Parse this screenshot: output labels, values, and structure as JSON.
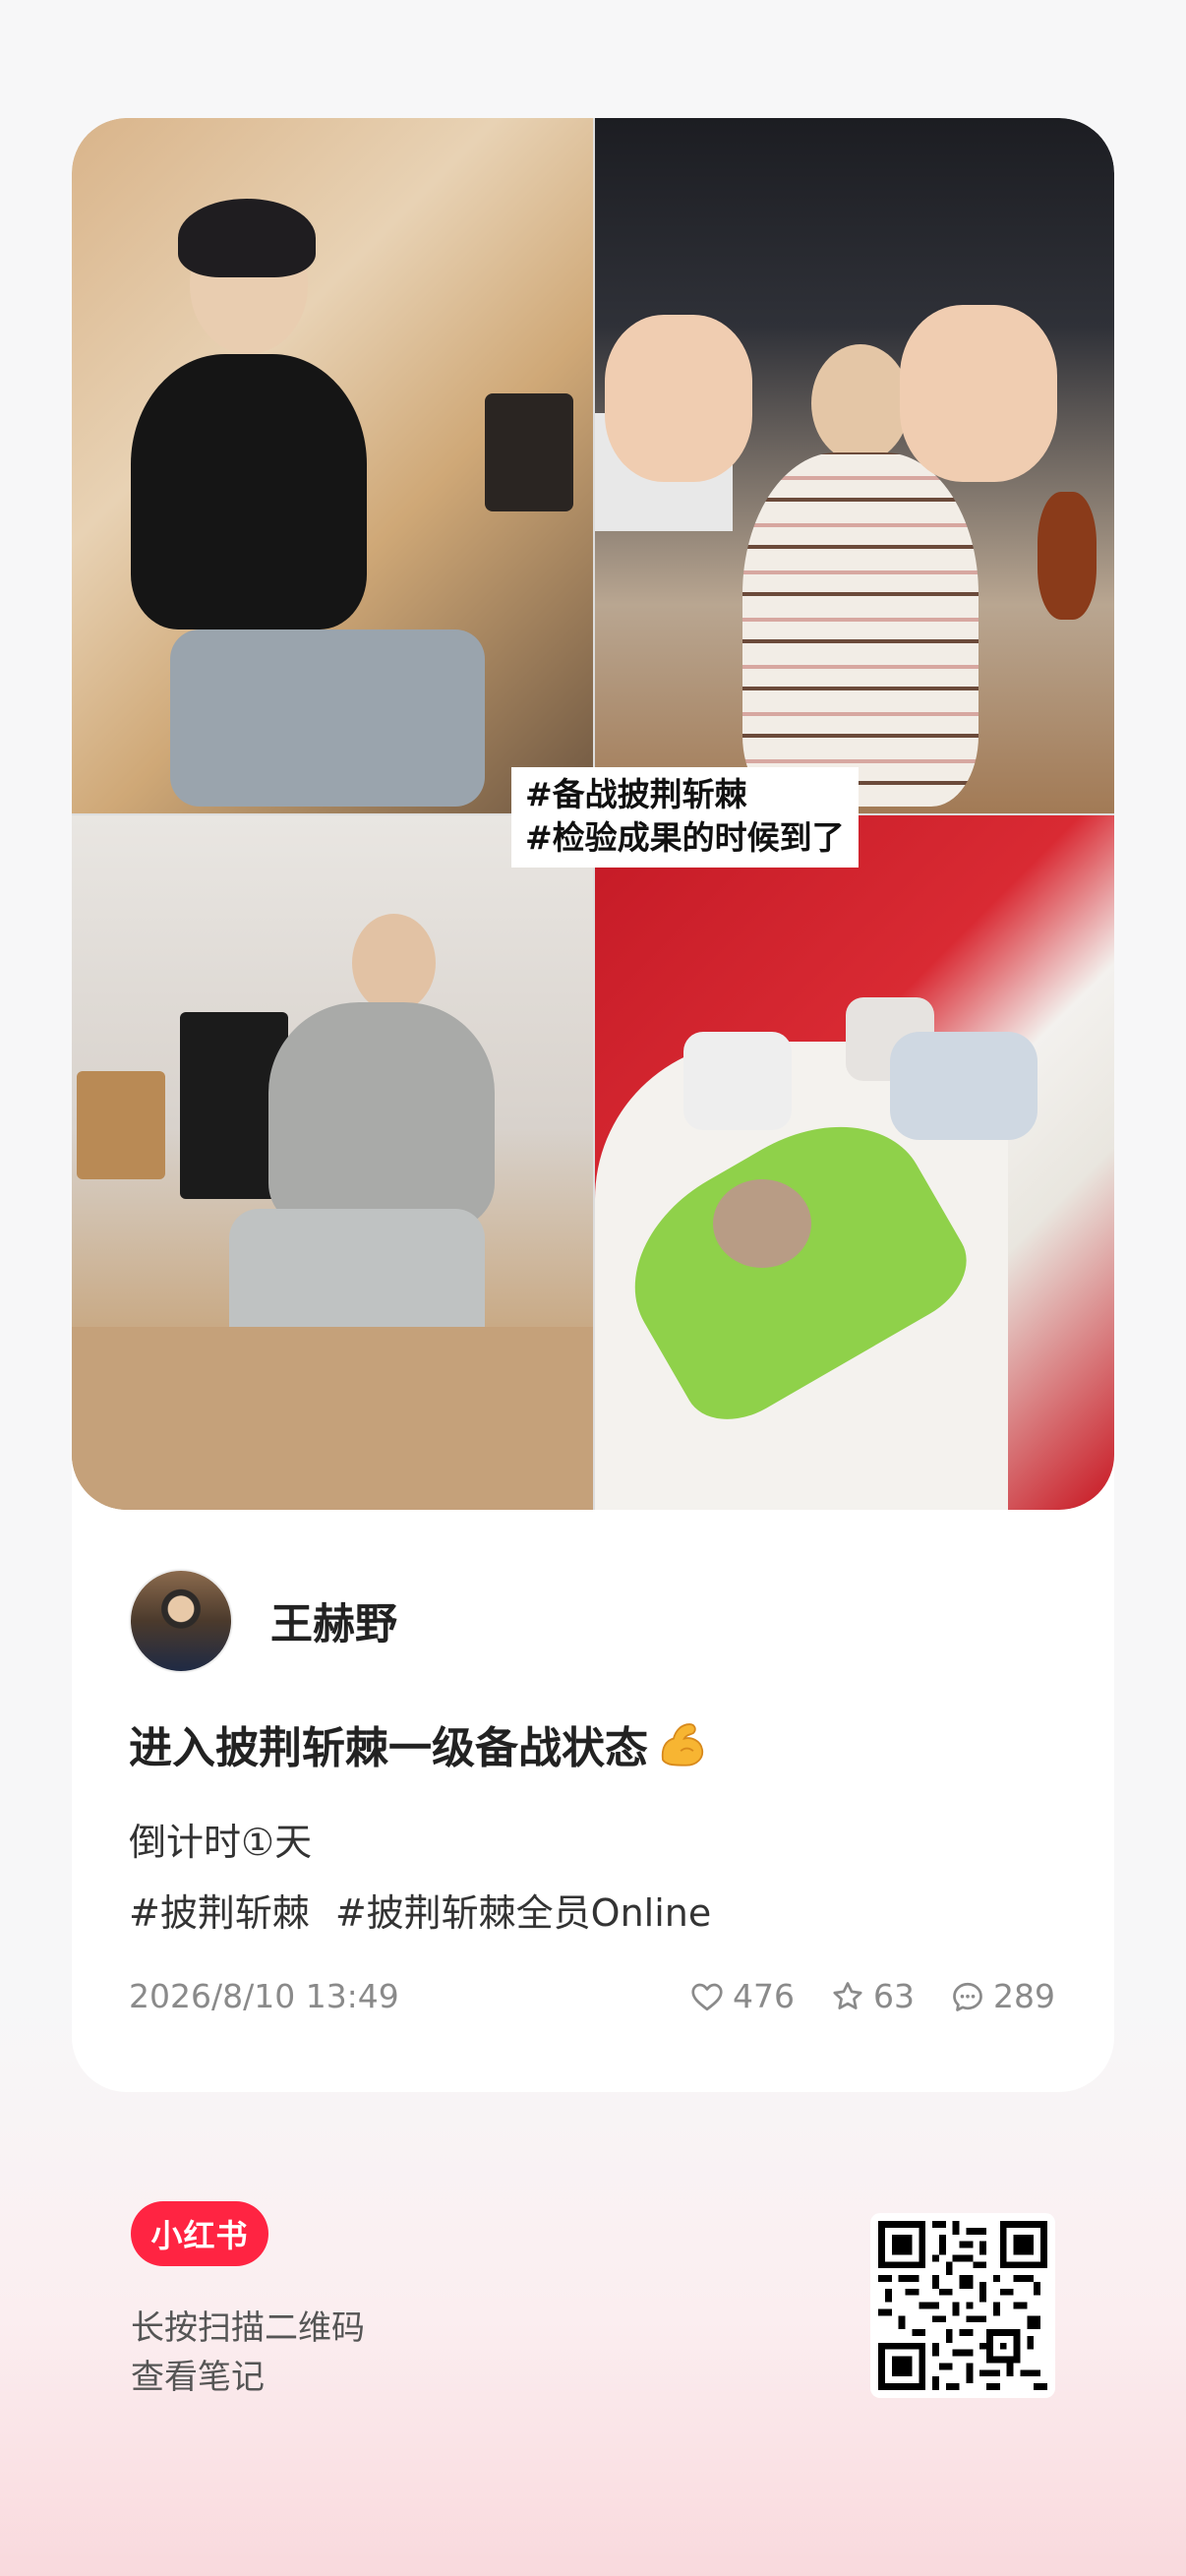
{
  "photo_caption": {
    "line1": "#备战披荆斩棘",
    "line2": "#检验成果的时候到了"
  },
  "author": {
    "name": "王赫野"
  },
  "note": {
    "title": "进入披荆斩棘一级备战状态",
    "title_emoji": "muscle-emoji",
    "line1": "倒计时①天",
    "tags": [
      "#披荆斩棘",
      "#披荆斩棘全员Online"
    ]
  },
  "meta": {
    "date": "2026/8/10 13:49",
    "likes": "476",
    "collects": "63",
    "comments": "289"
  },
  "footer": {
    "brand": "小红书",
    "hint_line1": "长按扫描二维码",
    "hint_line2": "查看笔记"
  },
  "colors": {
    "brand_red": "#ff2442",
    "meta_gray": "#8a8a8a"
  },
  "icons": {
    "like": "heart-icon",
    "collect": "star-icon",
    "comment": "comment-icon",
    "qr": "qr-code-icon"
  }
}
